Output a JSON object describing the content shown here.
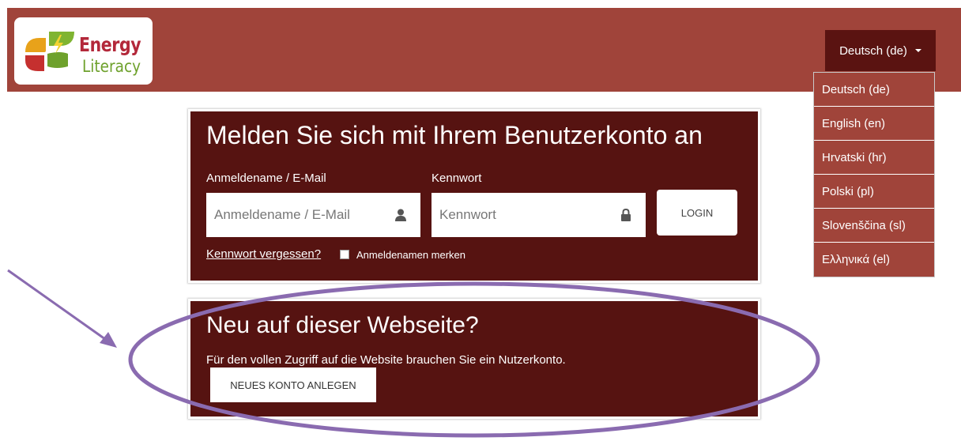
{
  "logo": {
    "line1": "Energy",
    "line2": "Literacy"
  },
  "language": {
    "current": "Deutsch (de)",
    "options": [
      "Deutsch (de)",
      "English (en)",
      "Hrvatski (hr)",
      "Polski (pl)",
      "Slovenščina (sl)",
      "Ελληνικά (el)"
    ]
  },
  "login": {
    "title": "Melden Sie sich mit Ihrem Benutzerkonto an",
    "username_label": "Anmeldename / E-Mail",
    "username_placeholder": "Anmeldename / E-Mail",
    "password_label": "Kennwort",
    "password_placeholder": "Kennwort",
    "login_button": "LOGIN",
    "forgot_link": "Kennwort vergessen?",
    "remember_label": "Anmeldenamen merken"
  },
  "signup": {
    "title": "Neu auf dieser Webseite?",
    "text": "Für den vollen Zugriff auf die Website brauchen Sie ein Nutzerkonto.",
    "button": "NEUES KONTO ANLEGEN"
  },
  "colors": {
    "header": "#a0443a",
    "card": "#561311",
    "annotation": "#8a6bb0"
  }
}
